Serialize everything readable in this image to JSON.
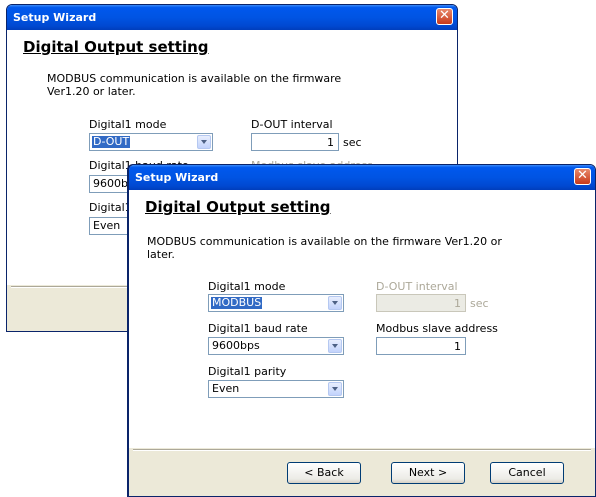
{
  "back": {
    "title": "Setup Wizard",
    "heading": "Digital Output setting",
    "info": "MODBUS communication is available on the firmware Ver1.20 or later.",
    "mode_label": "Digital1 mode",
    "mode_value": "D-OUT",
    "interval_label": "D-OUT interval",
    "interval_value": "1",
    "interval_unit": "sec",
    "baud_label": "Digital1 baud rate",
    "baud_value": "9600bps",
    "slave_label": "Modbus slave address",
    "parity_label": "Digital1 parity",
    "parity_value": "Even"
  },
  "front": {
    "title": "Setup Wizard",
    "heading": "Digital Output setting",
    "info": "MODBUS communication is available on the firmware Ver1.20 or later.",
    "mode_label": "Digital1 mode",
    "mode_value": "MODBUS",
    "interval_label": "D-OUT interval",
    "interval_value": "1",
    "interval_unit": "sec",
    "baud_label": "Digital1 baud rate",
    "baud_value": "9600bps",
    "slave_label": "Modbus slave address",
    "slave_value": "1",
    "parity_label": "Digital1 parity",
    "parity_value": "Even",
    "buttons": {
      "back": "< Back",
      "next": "Next >",
      "cancel": "Cancel"
    }
  },
  "icons": {
    "close": "close-icon",
    "dropdown": "chevron-down-icon"
  },
  "colors": {
    "titlebar": "#0054e3",
    "dialog_bg": "#ece9d8",
    "selection": "#316ac5"
  }
}
